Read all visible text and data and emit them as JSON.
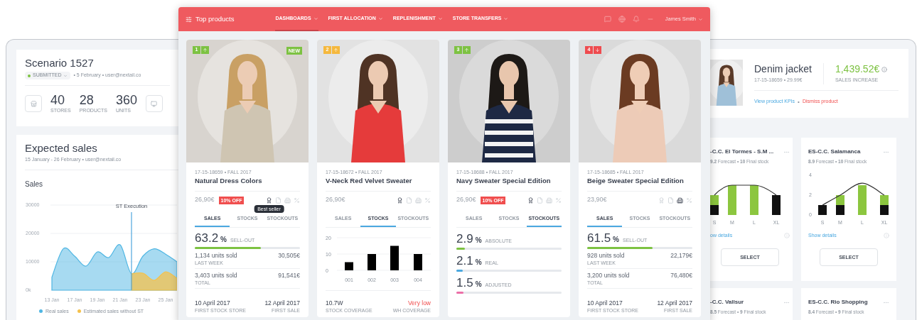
{
  "scenario": {
    "title": "Scenario 1527",
    "status": {
      "label": "SUBMITTED",
      "color": "#7dc242"
    },
    "meta": "• 5 February • user@nextail.co",
    "stats": [
      {
        "value": "40",
        "label": "STORES"
      },
      {
        "value": "28",
        "label": "PRODUCTS"
      },
      {
        "value": "360",
        "label": "UNITS"
      }
    ]
  },
  "expected_sales": {
    "title": "Expected sales",
    "meta": "15 January - 26 February • user@nextail.co",
    "section": "Sales",
    "chart_data": {
      "type": "area",
      "categories": [
        "13 Jan",
        null,
        "17 Jan",
        null,
        "19 Jan",
        null,
        "21 Jan",
        null,
        "23 Jan",
        null,
        "25 Jan",
        null
      ],
      "yticks": [
        {
          "value": 0,
          "label": "0k"
        },
        {
          "value": 10000,
          "label": "10000"
        },
        {
          "value": 20000,
          "label": "20000"
        },
        {
          "value": 30000,
          "label": "30000"
        }
      ],
      "ylim": [
        0,
        30000
      ],
      "series": [
        {
          "name": "Real sales",
          "color": "#4fb6e3",
          "values": [
            4600,
            14600,
            12000,
            8500,
            13500,
            11500,
            16000,
            5800,
            12000,
            14600,
            12700,
            10000
          ]
        },
        {
          "name": "Estimated sales without ST",
          "color": "#f5c14b",
          "values": [
            null,
            null,
            null,
            null,
            null,
            null,
            null,
            5800,
            6000,
            3500,
            6500,
            4200
          ]
        }
      ],
      "legend": "bottom",
      "annotations": [
        {
          "text": "ST Execution"
        }
      ]
    }
  },
  "header": {
    "title": "Top products",
    "nav": [
      {
        "label": "DASHBOARDS",
        "selected": true
      },
      {
        "label": "FIRST ALLOCATION",
        "selected": false
      },
      {
        "label": "REPLENISHMENT",
        "selected": false
      },
      {
        "label": "STORE TRANSFERS",
        "selected": false
      }
    ],
    "user": "James Smith"
  },
  "products": [
    {
      "rank": "1",
      "color": "#7dc242",
      "kind": "up",
      "new_badge": "NEW",
      "code": "17-15-18659 • FALL 2017",
      "name": "Natural Dress Colors",
      "price": "26,90€",
      "discount": "10% OFF",
      "flags": [
        {
          "on": true,
          "tooltip": "Best seller"
        },
        {
          "on": false
        },
        {
          "on": false
        },
        {
          "on": false
        }
      ],
      "tabs": [
        {
          "label": "SALES",
          "selected": true
        },
        {
          "label": "STOCKS",
          "selected": false
        },
        {
          "label": "STOCKOUTS",
          "selected": false
        }
      ],
      "panel": {
        "kind": "sales",
        "value": "63.2",
        "unit": "%",
        "caption": "SELL-OUT",
        "level": 0.63,
        "rows": [
          {
            "primary": "1,134 units sold",
            "secondary": "LAST WEEK",
            "value": "30,505€"
          },
          {
            "primary": "3,403 units sold",
            "secondary": "TOTAL",
            "value": "91,541€"
          }
        ],
        "footer": [
          {
            "value": "10 April 2017",
            "caption": "FIRST STOCK STORE",
            "alert": false
          },
          {
            "value": "12 April 2017",
            "caption": "FIRST SALE",
            "alert": false
          }
        ]
      }
    },
    {
      "rank": "2",
      "color": "#f5b83d",
      "kind": "up",
      "code": "17-15-18672 • FALL 2017",
      "name": "V-Neck Red Velvet Sweater",
      "price": "26,90€",
      "flags": [
        {
          "on": true
        },
        {
          "on": false
        },
        {
          "on": false
        },
        {
          "on": false
        }
      ],
      "tabs": [
        {
          "label": "SALES",
          "selected": false
        },
        {
          "label": "STOCKS",
          "selected": true
        },
        {
          "label": "STOCKOUTS",
          "selected": false
        }
      ],
      "panel": {
        "kind": "stocks",
        "chart_data": {
          "type": "bar",
          "categories": [
            "001",
            "002",
            "003",
            "004"
          ],
          "values": [
            5,
            10,
            15,
            10
          ],
          "ylim": [
            0,
            20
          ],
          "yticks": [
            0,
            10,
            20
          ]
        },
        "footer": [
          {
            "value": "10.7W",
            "caption": "STOCK COVERAGE",
            "alert": false
          },
          {
            "value": "Very low",
            "caption": "WH COVERAGE",
            "alert": true
          }
        ]
      }
    },
    {
      "rank": "3",
      "color": "#7dc242",
      "kind": "up",
      "code": "17-15-18688 • FALL 2017",
      "name": "Navy Sweater Special Edition",
      "price": "26,90€",
      "discount": "10% OFF",
      "flags": [
        {
          "on": true
        },
        {
          "on": false
        },
        {
          "on": false
        },
        {
          "on": false
        }
      ],
      "tabs": [
        {
          "label": "SALES",
          "selected": false
        },
        {
          "label": "STOCKS",
          "selected": false
        },
        {
          "label": "STOCKOUTS",
          "selected": true
        }
      ],
      "panel": {
        "kind": "stockouts",
        "meters": [
          {
            "value": "2.9",
            "unit": "%",
            "caption": "ABSOLUTE",
            "level": 0.08,
            "color": "#7dc242"
          },
          {
            "value": "2.1",
            "unit": "%",
            "caption": "REAL",
            "level": 0.06,
            "color": "#4aa8e0"
          },
          {
            "value": "1.5",
            "unit": "%",
            "caption": "ADJUSTED",
            "level": 0.07,
            "color": "#ec6fa7"
          }
        ]
      }
    },
    {
      "rank": "4",
      "color": "#ef4b4f",
      "kind": "down",
      "code": "17-15-18685 • FALL 2017",
      "name": "Beige Sweater Special Edition",
      "price": "23,90€",
      "flags": [
        {
          "on": false
        },
        {
          "on": false
        },
        {
          "on": true
        },
        {
          "on": false
        }
      ],
      "tabs": [
        {
          "label": "SALES",
          "selected": true
        },
        {
          "label": "STOCKS",
          "selected": false
        },
        {
          "label": "STOCKOUTS",
          "selected": false
        }
      ],
      "panel": {
        "kind": "sales",
        "value": "61.5",
        "unit": "%",
        "caption": "SELL-OUT",
        "level": 0.62,
        "rows": [
          {
            "primary": "928 units sold",
            "secondary": "LAST WEEK",
            "value": "22,179€"
          },
          {
            "primary": "3,200 units sold",
            "secondary": "TOTAL",
            "value": "76,480€"
          }
        ],
        "footer": [
          {
            "value": "10 April 2017",
            "caption": "FIRST STOCK STORE",
            "alert": false
          },
          {
            "value": "12 April 2017",
            "caption": "FIRST SALE",
            "alert": false
          }
        ]
      }
    }
  ],
  "product_detail": {
    "name": "Denim jacket",
    "meta": "17-15-18659 • 29.99€",
    "amount": "1,439.52€",
    "caption": "SALES INCREASE",
    "links": [
      {
        "label": "View product KPIs",
        "kind": "primary"
      },
      {
        "label": "Dismiss product",
        "kind": "danger"
      }
    ],
    "separator": "•"
  },
  "stores": [
    {
      "name": "-C.C. El Tormes - S.M ...",
      "forecast": "**9.2** Forecast • **10** Final stock",
      "details": "ow details",
      "button": "SELECT",
      "chart": {
        "kind": "picture",
        "categories": [
          "S",
          "M",
          "L",
          "XL"
        ]
      }
    },
    {
      "name": "ES-C.C. Salamanca",
      "forecast": "**8.9** Forecast • **10** Final stock",
      "details": "Show details",
      "button": "SELECT",
      "chart_data": {
        "type": "bar",
        "stacked": true,
        "categories": [
          "S",
          "M",
          "L",
          "XL"
        ],
        "ylim": [
          0,
          4
        ],
        "yticks": [
          0,
          2,
          4
        ],
        "series": [
          {
            "color": "#111111",
            "values": [
              1,
              1,
              0,
              1
            ]
          },
          {
            "color": "#8cc63f",
            "values": [
              0,
              1,
              3,
              1
            ]
          },
          {
            "type": "line",
            "color": "#333333",
            "values": [
              1,
              2,
              3.2,
              2
            ]
          }
        ]
      }
    },
    {
      "name": "-C.C. Vallsur",
      "forecast": "**8.5** Forecast • **9** Final stock"
    },
    {
      "name": "ES-C.C. Rio Shopping",
      "forecast": "**8.4** Forecast • **9** Final stock"
    }
  ]
}
